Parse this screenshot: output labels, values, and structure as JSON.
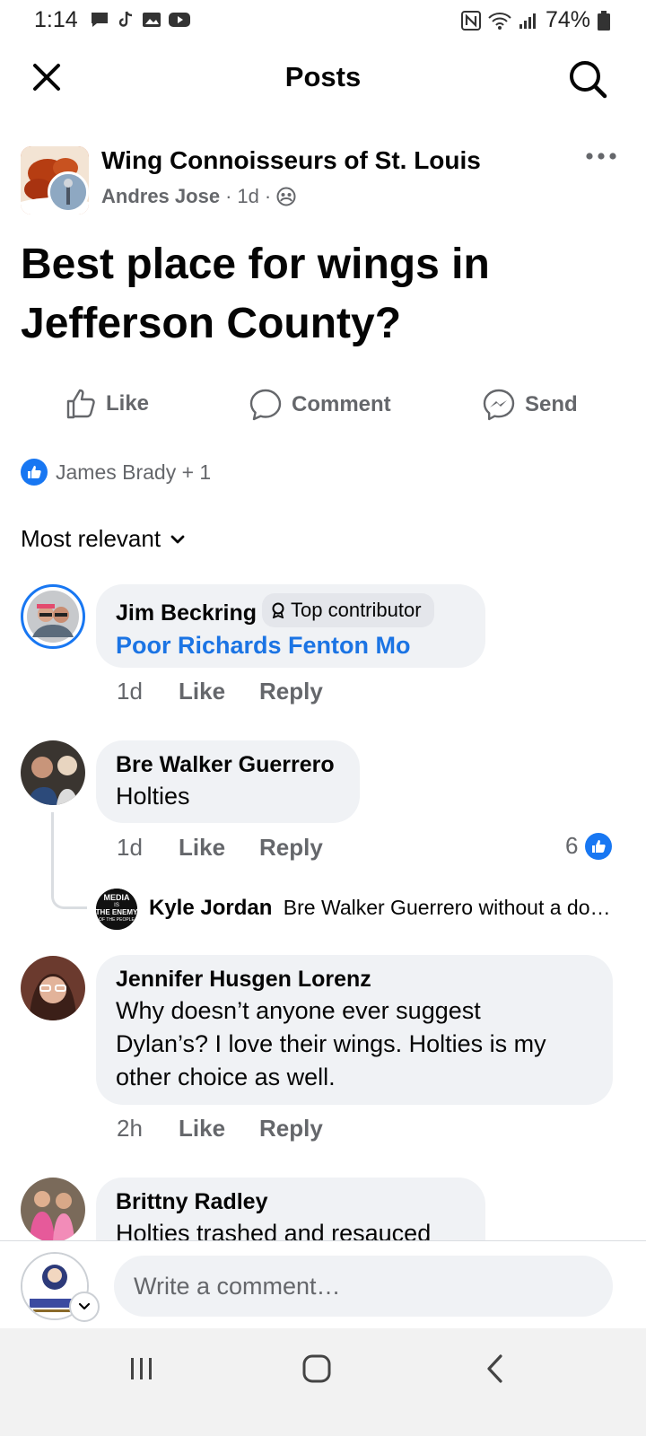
{
  "status_bar": {
    "time": "1:14",
    "battery": "74%"
  },
  "header": {
    "title": "Posts",
    "close_icon": "close-icon",
    "search_icon": "search-icon"
  },
  "post": {
    "group_name": "Wing Connoisseurs of St. Louis",
    "author": "Andres Jose",
    "age": "1d",
    "separator": "·",
    "title": "Best place for wings in Jefferson County?",
    "actions": {
      "like": "Like",
      "comment": "Comment",
      "send": "Send"
    },
    "reactions_text": "James Brady + 1",
    "sort_label": "Most relevant"
  },
  "comments": [
    {
      "name": "Jim Beckring",
      "badge": "Top contributor",
      "link": "Poor Richards Fenton Mo",
      "time": "1d",
      "like": "Like",
      "reply": "Reply"
    },
    {
      "name": "Bre Walker Guerrero",
      "text": "Holties",
      "time": "1d",
      "like": "Like",
      "reply": "Reply",
      "reaction_count": "6",
      "reply_preview": {
        "name": "Kyle Jordan",
        "text": "Bre Walker Guerrero without a do…",
        "avatar_text": [
          "MEDIA",
          "IS",
          "THE ENEMY",
          "OF THE PEOPLE"
        ]
      }
    },
    {
      "name": "Jennifer Husgen Lorenz",
      "lines": [
        "Why doesn’t anyone ever suggest",
        "Dylan’s? I love their wings. Holties is my",
        "other choice as well."
      ],
      "time": "2h",
      "like": "Like",
      "reply": "Reply"
    },
    {
      "name": "Brittny Radley",
      "text": "Holties trashed and resauced"
    }
  ],
  "composer": {
    "placeholder": "Write a comment…"
  },
  "colors": {
    "accent": "#1877f2",
    "link": "#1b74e4",
    "muted": "#65676b",
    "bubble": "#f0f2f5"
  }
}
